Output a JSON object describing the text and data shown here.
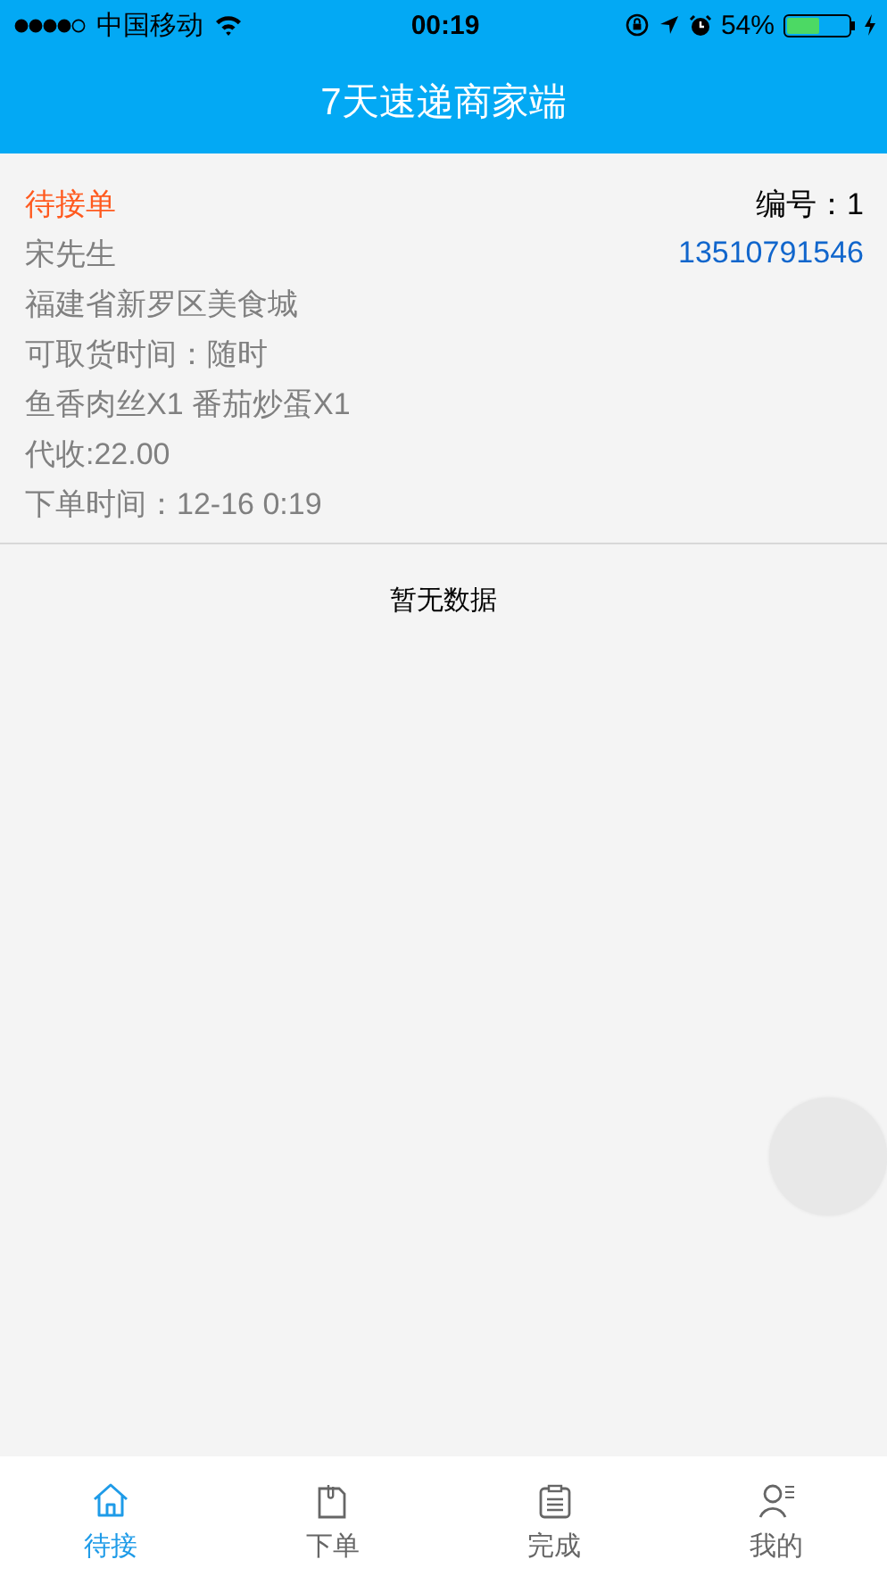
{
  "status_bar": {
    "carrier": "中国移动",
    "time": "00:19",
    "battery_text": "54%",
    "battery": {
      "level": 0.54
    }
  },
  "header": {
    "title": "7天速递商家端"
  },
  "orders": [
    {
      "status": "待接单",
      "number": "编号：1",
      "customer": "宋先生",
      "phone": "13510791546",
      "address": "福建省新罗区美食城",
      "pickup_time": "可取货时间：随时",
      "items": "鱼香肉丝X1 番茄炒蛋X1",
      "collect": "代收:22.00",
      "order_time": "下单时间：12-16 0:19"
    }
  ],
  "empty_text": "暂无数据",
  "floating_button": {
    "kind": "assistive"
  },
  "tabs": [
    {
      "label": "待接",
      "selected": true
    },
    {
      "label": "下单",
      "selected": false
    },
    {
      "label": "完成",
      "selected": false
    },
    {
      "label": "我的",
      "selected": false
    }
  ]
}
